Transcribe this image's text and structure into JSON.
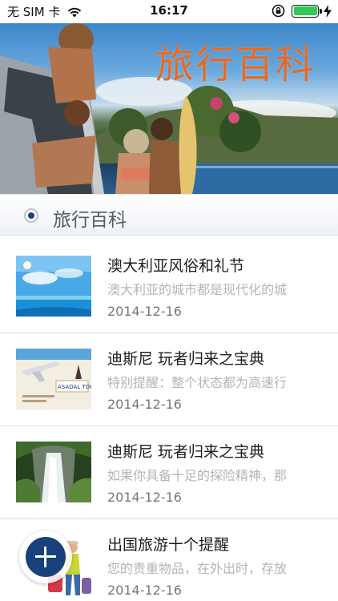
{
  "status_bar": {
    "carrier": "无 SIM 卡",
    "time": "16:17",
    "battery_level": 1.0
  },
  "banner": {
    "title": "旅行百科"
  },
  "section": {
    "title": "旅行百科"
  },
  "articles": [
    {
      "title": "澳大利亚风俗和礼节",
      "description": "澳大利亚的城市都是现代化的城",
      "date": "2014-12-16",
      "thumbnail_icon": "beach-sea-thumbnail"
    },
    {
      "title": "迪斯尼 玩者归来之宝典",
      "description": "特别提醒：整个状态都为高速行",
      "date": "2014-12-16",
      "thumbnail_icon": "travel-postcard-thumbnail",
      "thumbnail_text": "ASADAL TOUR"
    },
    {
      "title": "迪斯尼 玩者归来之宝典",
      "description": "如果你具备十足的探险精神，那",
      "date": "2014-12-16",
      "thumbnail_icon": "waterfall-thumbnail"
    },
    {
      "title": "出国旅游十个提醒",
      "description": "您的贵重物品，在外出时，存放",
      "date": "2014-12-16",
      "thumbnail_icon": "traveler-luggage-thumbnail"
    }
  ],
  "fab": {
    "icon": "plus-icon",
    "color": "#17407c"
  },
  "colors": {
    "banner_title": "#e46b27",
    "section_radio": "#1f3f7a",
    "battery": "#35c759"
  }
}
